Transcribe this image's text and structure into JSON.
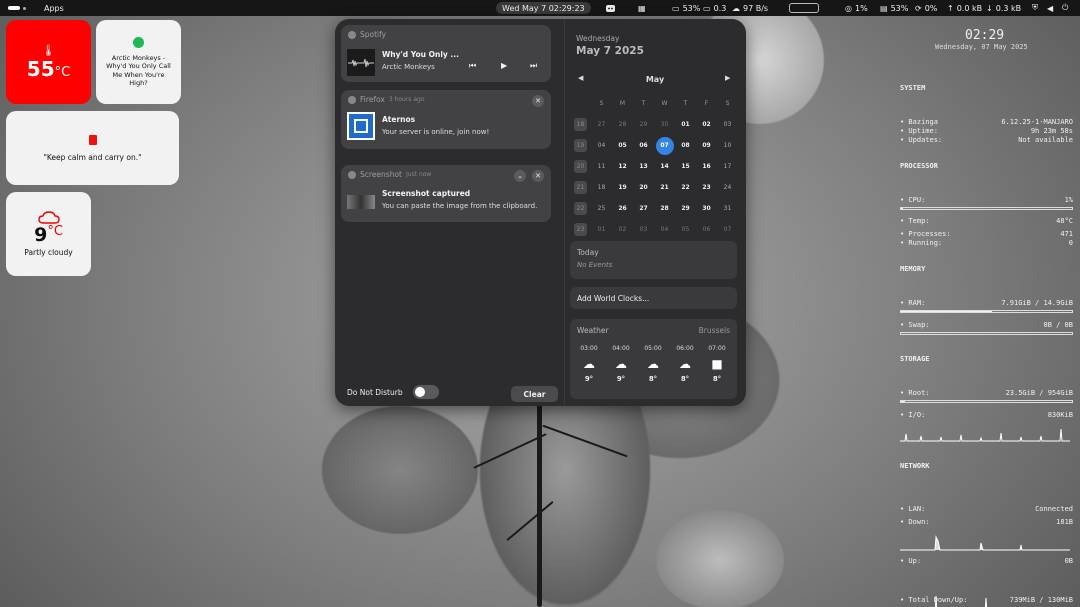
{
  "topbar": {
    "apps_label": "Apps",
    "clock": "Wed May 7  02:29:23",
    "discord_icon": "discord-icon",
    "cpu": "53%",
    "load": "0.3",
    "net": "97 B/s",
    "tray_cpu": "1%",
    "tray_ram": "53%",
    "tray_swap": "0%",
    "tray_up": "0.0 kB",
    "tray_down": "0.3 kB"
  },
  "widgets": {
    "temp": {
      "value": "55",
      "unit": "°C"
    },
    "music": {
      "text": "Arctic Monkeys - Why'd You Only Call Me When You're High?"
    },
    "quote": {
      "text": "\"Keep calm and carry on.\""
    },
    "weather": {
      "value": "9",
      "unit": "°C",
      "condition": "Partly cloudy"
    }
  },
  "notifications": {
    "spotify": {
      "app": "Spotify",
      "title": "Why'd You Only ...",
      "artist": "Arctic Monkeys"
    },
    "firefox": {
      "app": "Firefox",
      "time": "3 hours ago",
      "title": "Aternos",
      "body": "Your server is online, join now!"
    },
    "screenshot": {
      "app": "Screenshot",
      "time": "Just now",
      "title": "Screenshot captured",
      "body": "You can paste the image from the clipboard."
    },
    "dnd_label": "Do Not Disturb",
    "clear_label": "Clear"
  },
  "calendar": {
    "weekday": "Wednesday",
    "date": "May 7 2025",
    "month": "May",
    "headers": [
      "S",
      "M",
      "T",
      "W",
      "T",
      "F",
      "S"
    ],
    "weeks": [
      {
        "wk": "18",
        "days": [
          "27",
          "28",
          "29",
          "30",
          "01",
          "02",
          "03"
        ]
      },
      {
        "wk": "19",
        "days": [
          "04",
          "05",
          "06",
          "07",
          "08",
          "09",
          "10"
        ]
      },
      {
        "wk": "20",
        "days": [
          "11",
          "12",
          "13",
          "14",
          "15",
          "16",
          "17"
        ]
      },
      {
        "wk": "21",
        "days": [
          "18",
          "19",
          "20",
          "21",
          "22",
          "23",
          "24"
        ]
      },
      {
        "wk": "22",
        "days": [
          "25",
          "26",
          "27",
          "28",
          "29",
          "30",
          "31"
        ]
      },
      {
        "wk": "23",
        "days": [
          "01",
          "02",
          "03",
          "04",
          "05",
          "06",
          "07"
        ]
      }
    ],
    "today_label": "Today",
    "no_events": "No Events",
    "world_clocks": "Add World Clocks...",
    "weather_title": "Weather",
    "weather_city": "Brussels",
    "forecast": [
      {
        "time": "03:00",
        "temp": "9°"
      },
      {
        "time": "04:00",
        "temp": "9°"
      },
      {
        "time": "05:00",
        "temp": "8°"
      },
      {
        "time": "06:00",
        "temp": "8°"
      },
      {
        "time": "07:00",
        "temp": "8°"
      }
    ]
  },
  "conky": {
    "clock": "02:29",
    "date": "Wednesday, 07 May 2025",
    "system": "SYSTEM",
    "host_label": "• Bazinga",
    "host_value": "6.12.25-1-MANJARO",
    "uptime_label": "• Uptime:",
    "uptime_value": "9h 23m 58s",
    "updates_label": "• Updates:",
    "updates_value": "Not available",
    "processor": "PROCESSOR",
    "cpu_label": "• CPU:",
    "cpu_value": "1%",
    "cpu_fill": 0.01,
    "temp_label": "• Temp:",
    "temp_value": "48°C",
    "proc_label": "• Processes:",
    "proc_value": "471",
    "run_label": "• Running:",
    "run_value": "0",
    "memory": "MEMORY",
    "ram_label": "• RAM:",
    "ram_value": "7.91GiB / 14.9GiB",
    "ram_fill": 0.53,
    "swap_label": "• Swap:",
    "swap_value": "0B / 0B",
    "swap_fill": 0,
    "storage": "STORAGE",
    "root_label": "• Root:",
    "root_value": "23.5GiB / 954GiB",
    "root_fill": 0.025,
    "io_label": "• I/O:",
    "io_value": "830KiB",
    "network": "NETWORK",
    "lan_label": "• LAN:",
    "lan_value": "Connected",
    "down_label": "• Down:",
    "down_value": "181B",
    "up_label": "• Up:",
    "up_value": "0B",
    "total_label": "• Total Down/Up:",
    "total_value": "739MiB / 130MiB"
  }
}
